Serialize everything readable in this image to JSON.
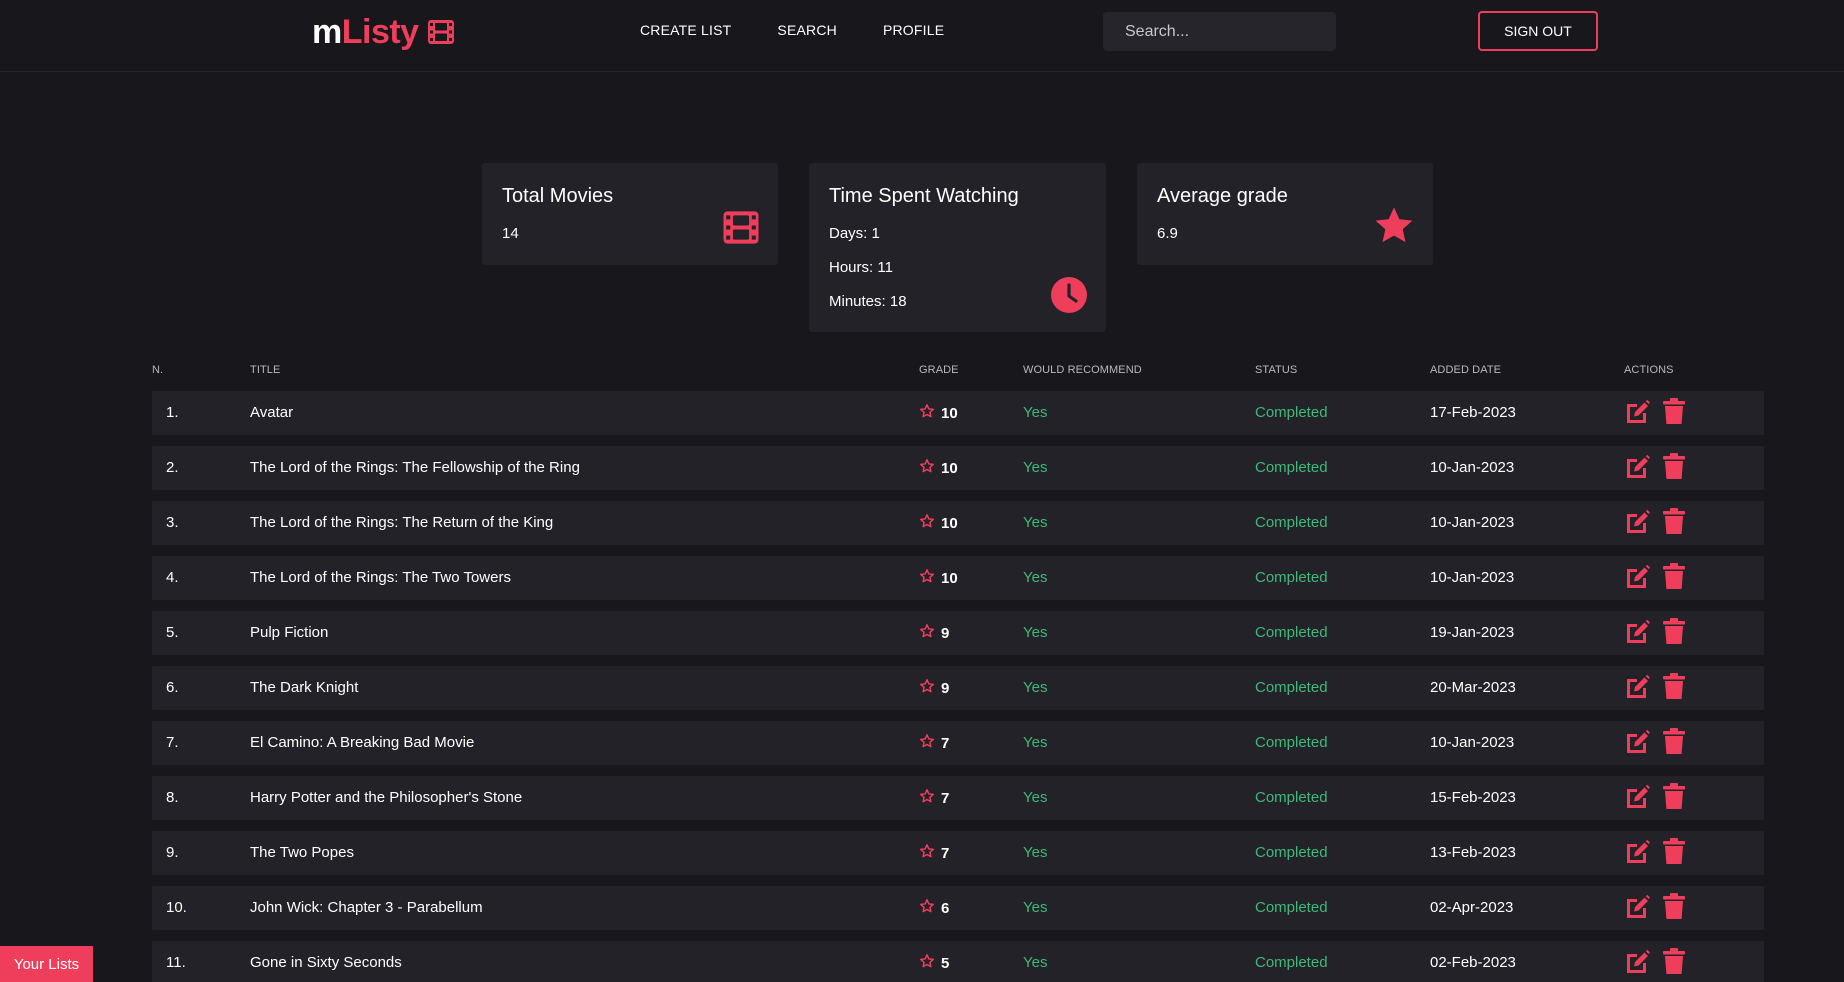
{
  "brand": {
    "prefix": "m",
    "name": "Listy",
    "icon": "film-icon",
    "accent": "#ef3e5b"
  },
  "nav": [
    {
      "label": "CREATE LIST"
    },
    {
      "label": "SEARCH"
    },
    {
      "label": "PROFILE"
    }
  ],
  "search": {
    "placeholder": "Search...",
    "value": ""
  },
  "signout_label": "SIGN OUT",
  "stats": {
    "total": {
      "title": "Total Movies",
      "value": "14",
      "icon": "film-icon"
    },
    "time": {
      "title": "Time Spent Watching",
      "days": "Days: 1",
      "hours": "Hours: 11",
      "minutes": "Minutes: 18",
      "icon": "clock-icon"
    },
    "average": {
      "title": "Average grade",
      "value": "6.9",
      "icon": "star-icon"
    }
  },
  "table": {
    "headers": {
      "num": "N.",
      "title": "TITLE",
      "grade": "GRADE",
      "recommend": "WOULD RECOMMEND",
      "status": "STATUS",
      "date": "ADDED DATE",
      "actions": "ACTIONS"
    },
    "rows": [
      {
        "num": "1.",
        "title": "Avatar",
        "grade": "10",
        "recommend": "Yes",
        "status": "Completed",
        "date": "17-Feb-2023"
      },
      {
        "num": "2.",
        "title": "The Lord of the Rings: The Fellowship of the Ring",
        "grade": "10",
        "recommend": "Yes",
        "status": "Completed",
        "date": "10-Jan-2023"
      },
      {
        "num": "3.",
        "title": "The Lord of the Rings: The Return of the King",
        "grade": "10",
        "recommend": "Yes",
        "status": "Completed",
        "date": "10-Jan-2023"
      },
      {
        "num": "4.",
        "title": "The Lord of the Rings: The Two Towers",
        "grade": "10",
        "recommend": "Yes",
        "status": "Completed",
        "date": "10-Jan-2023"
      },
      {
        "num": "5.",
        "title": "Pulp Fiction",
        "grade": "9",
        "recommend": "Yes",
        "status": "Completed",
        "date": "19-Jan-2023"
      },
      {
        "num": "6.",
        "title": "The Dark Knight",
        "grade": "9",
        "recommend": "Yes",
        "status": "Completed",
        "date": "20-Mar-2023"
      },
      {
        "num": "7.",
        "title": "El Camino: A Breaking Bad Movie",
        "grade": "7",
        "recommend": "Yes",
        "status": "Completed",
        "date": "10-Jan-2023"
      },
      {
        "num": "8.",
        "title": "Harry Potter and the Philosopher's Stone",
        "grade": "7",
        "recommend": "Yes",
        "status": "Completed",
        "date": "15-Feb-2023"
      },
      {
        "num": "9.",
        "title": "The Two Popes",
        "grade": "7",
        "recommend": "Yes",
        "status": "Completed",
        "date": "13-Feb-2023"
      },
      {
        "num": "10.",
        "title": "John Wick: Chapter 3 - Parabellum",
        "grade": "6",
        "recommend": "Yes",
        "status": "Completed",
        "date": "02-Apr-2023"
      },
      {
        "num": "11.",
        "title": "Gone in Sixty Seconds",
        "grade": "5",
        "recommend": "Yes",
        "status": "Completed",
        "date": "02-Feb-2023"
      }
    ],
    "row_icons": {
      "grade": "star-outline-icon",
      "edit": "edit-icon",
      "delete": "trash-icon"
    }
  },
  "your_lists_label": "Your Lists",
  "colors": {
    "accent": "#ef3e5b",
    "positive": "#3fb979",
    "background": "#17171c",
    "card": "#222228"
  }
}
